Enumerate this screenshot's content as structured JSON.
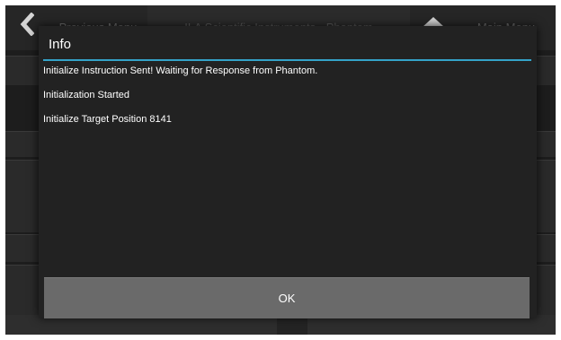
{
  "header": {
    "back_label": "Previous Menu",
    "title": "ILA Scientific Instruments - Phantom",
    "menu_label": "Main Menu",
    "back_icon": "chevron-left-icon",
    "home_icon": "home-icon"
  },
  "dialog": {
    "title": "Info",
    "messages": [
      "Initialize Instruction Sent! Waiting for Response from Phantom.",
      "Initialization Started",
      "Initialize Target Position 8141"
    ],
    "ok_label": "OK",
    "accent_color": "#34a3c9"
  }
}
